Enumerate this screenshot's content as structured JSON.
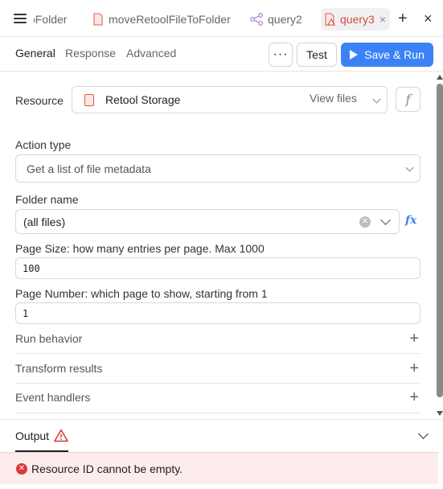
{
  "tabs": {
    "clipped": "oFolder",
    "move": "moveRetoolFileToFolder",
    "query2": "query2",
    "query3": "query3",
    "close_glyph": "×",
    "add_glyph": "+",
    "panel_close_glyph": "×"
  },
  "header": {
    "general": "General",
    "response": "Response",
    "advanced": "Advanced",
    "more": "···",
    "test": "Test",
    "save_run": "Save & Run"
  },
  "form": {
    "resource_label": "Resource",
    "resource_value": "Retool Storage",
    "view_files": "View files",
    "f_glyph": "f",
    "action_type_label": "Action type",
    "action_type_value": "Get a list of file metadata",
    "folder_label": "Folder name",
    "folder_value": "(all files)",
    "fx_glyph": "fx",
    "page_size_label": "Page Size: how many entries per page. Max 1000",
    "page_size_value": "100",
    "page_number_label": "Page Number: which page to show, starting from 1",
    "page_number_value": "1"
  },
  "sections": {
    "run_behavior": "Run behavior",
    "transform_results": "Transform results",
    "event_handlers": "Event handlers",
    "plus_glyph": "+"
  },
  "output": {
    "title": "Output",
    "error": "Resource ID cannot be empty."
  },
  "colors": {
    "accent": "#3b82f6",
    "error": "#d93838",
    "error_bg": "#fdecec",
    "query3_tab": "#d14a3a"
  },
  "icons": [
    "hamburger-icon",
    "file-icon",
    "share-nodes-icon",
    "warning-icon",
    "chevron-down-icon",
    "clear-icon",
    "play-icon",
    "plus-icon",
    "close-icon",
    "error-icon"
  ]
}
